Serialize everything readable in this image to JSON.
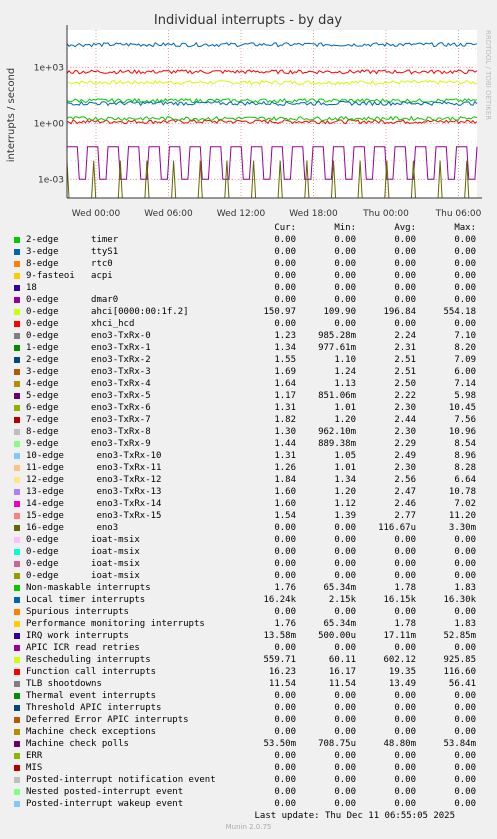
{
  "chart_data": {
    "type": "line",
    "title": "Individual interrupts - by day",
    "ylabel": "interrupts / second",
    "y_scale": "log",
    "ylim": [
      0.0001,
      100000
    ],
    "y_ticks": [
      {
        "v": 1000,
        "label": "1e+03"
      },
      {
        "v": 1,
        "label": "1e+00"
      },
      {
        "v": 0.001,
        "label": "1e-03"
      }
    ],
    "x_ticks": [
      "Wed 00:00",
      "Wed 06:00",
      "Wed 12:00",
      "Wed 18:00",
      "Thu 00:00",
      "Thu 06:00"
    ],
    "watermark": "RRDTOOL / TOBI OETIKER",
    "grid": true,
    "series": [
      {
        "name": "2-edge timer",
        "color": "#00cc00",
        "level": 0
      },
      {
        "name": "3-edge ttyS1",
        "color": "#0066b3",
        "level": 0
      },
      {
        "name": "8-edge rtc0",
        "color": "#ff8000",
        "level": 0
      },
      {
        "name": "9-fasteoi acpi",
        "color": "#ffcc00",
        "level": 0
      },
      {
        "name": "18",
        "color": "#330099",
        "level": 0
      },
      {
        "name": "0-edge dmar0",
        "color": "#990099",
        "level": 0
      },
      {
        "name": "0-edge ahci[0000:00:1f.2]",
        "color": "#ccff00",
        "level": 150
      },
      {
        "name": "0-edge eno3-TxRx-0",
        "color": "#ff0000",
        "level": 1.2
      },
      {
        "name": "Local timer interrupts",
        "color": "#0066b3",
        "level": 16000
      },
      {
        "name": "Rescheduling interrupts",
        "color": "#ff0000",
        "level": 560
      },
      {
        "name": "Function call interrupts",
        "color": "#00cc00",
        "level": 16
      },
      {
        "name": "TLB shootdowns",
        "color": "#0066b3",
        "level": 11.5
      },
      {
        "name": "Machine check polls",
        "color": "#990099",
        "level": 0.05
      },
      {
        "name": "16-edge eno3",
        "color": "#666600",
        "level": 0.0001
      },
      {
        "name": "Non-maskable interrupts",
        "color": "#00cc00",
        "level": 1.76
      }
    ]
  },
  "legend": {
    "headers": {
      "cur": "Cur:",
      "min": "Min:",
      "avg": "Avg:",
      "max": "Max:"
    },
    "rows": [
      {
        "label": "2-edge      timer",
        "color": "#00cc00",
        "cur": "0.00",
        "min": "0.00",
        "avg": "0.00",
        "max": "0.00"
      },
      {
        "label": "3-edge      ttyS1",
        "color": "#0066b3",
        "cur": "0.00",
        "min": "0.00",
        "avg": "0.00",
        "max": "0.00"
      },
      {
        "label": "8-edge      rtc0",
        "color": "#ff8000",
        "cur": "0.00",
        "min": "0.00",
        "avg": "0.00",
        "max": "0.00"
      },
      {
        "label": "9-fasteoi   acpi",
        "color": "#ffcc00",
        "cur": "0.00",
        "min": "0.00",
        "avg": "0.00",
        "max": "0.00"
      },
      {
        "label": "18",
        "color": "#330099",
        "cur": "0.00",
        "min": "0.00",
        "avg": "0.00",
        "max": "0.00"
      },
      {
        "label": "0-edge      dmar0",
        "color": "#990099",
        "cur": "0.00",
        "min": "0.00",
        "avg": "0.00",
        "max": "0.00"
      },
      {
        "label": "0-edge      ahci[0000:00:1f.2]",
        "color": "#ccff00",
        "cur": "150.97",
        "min": "109.90",
        "avg": "196.84",
        "max": "554.18"
      },
      {
        "label": "0-edge      xhci_hcd",
        "color": "#ff0000",
        "cur": "0.00",
        "min": "0.00",
        "avg": "0.00",
        "max": "0.00"
      },
      {
        "label": "0-edge      eno3-TxRx-0",
        "color": "#808080",
        "cur": "1.23",
        "min": "985.28m",
        "avg": "2.24",
        "max": "7.10"
      },
      {
        "label": "1-edge      eno3-TxRx-1",
        "color": "#008f00",
        "cur": "1.34",
        "min": "977.61m",
        "avg": "2.31",
        "max": "8.20"
      },
      {
        "label": "2-edge      eno3-TxRx-2",
        "color": "#00487d",
        "cur": "1.55",
        "min": "1.10",
        "avg": "2.51",
        "max": "7.09"
      },
      {
        "label": "3-edge      eno3-TxRx-3",
        "color": "#b35a00",
        "cur": "1.69",
        "min": "1.24",
        "avg": "2.51",
        "max": "6.00"
      },
      {
        "label": "4-edge      eno3-TxRx-4",
        "color": "#b38f00",
        "cur": "1.64",
        "min": "1.13",
        "avg": "2.50",
        "max": "7.14"
      },
      {
        "label": "5-edge      eno3-TxRx-5",
        "color": "#6b006b",
        "cur": "1.17",
        "min": "851.06m",
        "avg": "2.22",
        "max": "5.98"
      },
      {
        "label": "6-edge      eno3-TxRx-6",
        "color": "#8fb300",
        "cur": "1.31",
        "min": "1.01",
        "avg": "2.30",
        "max": "10.45"
      },
      {
        "label": "7-edge      eno3-TxRx-7",
        "color": "#b30000",
        "cur": "1.82",
        "min": "1.20",
        "avg": "2.44",
        "max": "7.56"
      },
      {
        "label": "8-edge      eno3-TxRx-8",
        "color": "#bebebe",
        "cur": "1.30",
        "min": "962.10m",
        "avg": "2.30",
        "max": "10.96"
      },
      {
        "label": "9-edge      eno3-TxRx-9",
        "color": "#80ff80",
        "cur": "1.44",
        "min": "889.38m",
        "avg": "2.29",
        "max": "8.54"
      },
      {
        "label": "10-edge      eno3-TxRx-10",
        "color": "#80c9ff",
        "cur": "1.31",
        "min": "1.05",
        "avg": "2.49",
        "max": "8.96"
      },
      {
        "label": "11-edge      eno3-TxRx-11",
        "color": "#ffc080",
        "cur": "1.26",
        "min": "1.01",
        "avg": "2.30",
        "max": "8.28"
      },
      {
        "label": "12-edge      eno3-TxRx-12",
        "color": "#ffe680",
        "cur": "1.84",
        "min": "1.34",
        "avg": "2.56",
        "max": "6.64"
      },
      {
        "label": "13-edge      eno3-TxRx-13",
        "color": "#aa80ff",
        "cur": "1.60",
        "min": "1.20",
        "avg": "2.47",
        "max": "10.78"
      },
      {
        "label": "14-edge      eno3-TxRx-14",
        "color": "#ee00cc",
        "cur": "1.60",
        "min": "1.12",
        "avg": "2.46",
        "max": "7.02"
      },
      {
        "label": "15-edge      eno3-TxRx-15",
        "color": "#ff8080",
        "cur": "1.54",
        "min": "1.39",
        "avg": "2.77",
        "max": "11.20"
      },
      {
        "label": "16-edge      eno3",
        "color": "#666600",
        "cur": "0.00",
        "min": "0.00",
        "avg": "116.67u",
        "max": "3.30m"
      },
      {
        "label": "0-edge      ioat-msix",
        "color": "#ffbfff",
        "cur": "0.00",
        "min": "0.00",
        "avg": "0.00",
        "max": "0.00"
      },
      {
        "label": "0-edge      ioat-msix",
        "color": "#00ffcc",
        "cur": "0.00",
        "min": "0.00",
        "avg": "0.00",
        "max": "0.00"
      },
      {
        "label": "0-edge      ioat-msix",
        "color": "#cc6699",
        "cur": "0.00",
        "min": "0.00",
        "avg": "0.00",
        "max": "0.00"
      },
      {
        "label": "0-edge      ioat-msix",
        "color": "#999900",
        "cur": "0.00",
        "min": "0.00",
        "avg": "0.00",
        "max": "0.00"
      },
      {
        "label": "Non-maskable interrupts",
        "color": "#00cc00",
        "cur": "1.76",
        "min": "65.34m",
        "avg": "1.78",
        "max": "1.83"
      },
      {
        "label": "Local timer interrupts",
        "color": "#0066b3",
        "cur": "16.24k",
        "min": "2.15k",
        "avg": "16.15k",
        "max": "16.30k"
      },
      {
        "label": "Spurious interrupts",
        "color": "#ff8000",
        "cur": "0.00",
        "min": "0.00",
        "avg": "0.00",
        "max": "0.00"
      },
      {
        "label": "Performance monitoring interrupts",
        "color": "#ffcc00",
        "cur": "1.76",
        "min": "65.34m",
        "avg": "1.78",
        "max": "1.83"
      },
      {
        "label": "IRQ work interrupts",
        "color": "#330099",
        "cur": "13.58m",
        "min": "500.00u",
        "avg": "17.11m",
        "max": "52.85m"
      },
      {
        "label": "APIC ICR read retries",
        "color": "#990099",
        "cur": "0.00",
        "min": "0.00",
        "avg": "0.00",
        "max": "0.00"
      },
      {
        "label": "Rescheduling interrupts",
        "color": "#ccff00",
        "cur": "559.71",
        "min": "60.11",
        "avg": "602.12",
        "max": "925.85"
      },
      {
        "label": "Function call interrupts",
        "color": "#ff0000",
        "cur": "16.23",
        "min": "16.17",
        "avg": "19.35",
        "max": "116.60"
      },
      {
        "label": "TLB shootdowns",
        "color": "#808080",
        "cur": "11.54",
        "min": "11.54",
        "avg": "13.49",
        "max": "56.41"
      },
      {
        "label": "Thermal event interrupts",
        "color": "#008f00",
        "cur": "0.00",
        "min": "0.00",
        "avg": "0.00",
        "max": "0.00"
      },
      {
        "label": "Threshold APIC interrupts",
        "color": "#00487d",
        "cur": "0.00",
        "min": "0.00",
        "avg": "0.00",
        "max": "0.00"
      },
      {
        "label": "Deferred Error APIC interrupts",
        "color": "#b35a00",
        "cur": "0.00",
        "min": "0.00",
        "avg": "0.00",
        "max": "0.00"
      },
      {
        "label": "Machine check exceptions",
        "color": "#b38f00",
        "cur": "0.00",
        "min": "0.00",
        "avg": "0.00",
        "max": "0.00"
      },
      {
        "label": "Machine check polls",
        "color": "#6b006b",
        "cur": "53.50m",
        "min": "708.75u",
        "avg": "48.80m",
        "max": "53.84m"
      },
      {
        "label": "ERR",
        "color": "#8fb300",
        "cur": "0.00",
        "min": "0.00",
        "avg": "0.00",
        "max": "0.00"
      },
      {
        "label": "MIS",
        "color": "#b30000",
        "cur": "0.00",
        "min": "0.00",
        "avg": "0.00",
        "max": "0.00"
      },
      {
        "label": "Posted-interrupt notification event",
        "color": "#bebebe",
        "cur": "0.00",
        "min": "0.00",
        "avg": "0.00",
        "max": "0.00"
      },
      {
        "label": "Nested posted-interrupt event",
        "color": "#80ff80",
        "cur": "0.00",
        "min": "0.00",
        "avg": "0.00",
        "max": "0.00"
      },
      {
        "label": "Posted-interrupt wakeup event",
        "color": "#80c9ff",
        "cur": "0.00",
        "min": "0.00",
        "avg": "0.00",
        "max": "0.00"
      }
    ]
  },
  "footer": {
    "last_update": "Last update: Thu Dec 11 06:55:05 2025",
    "version": "Munin 2.0.75"
  }
}
